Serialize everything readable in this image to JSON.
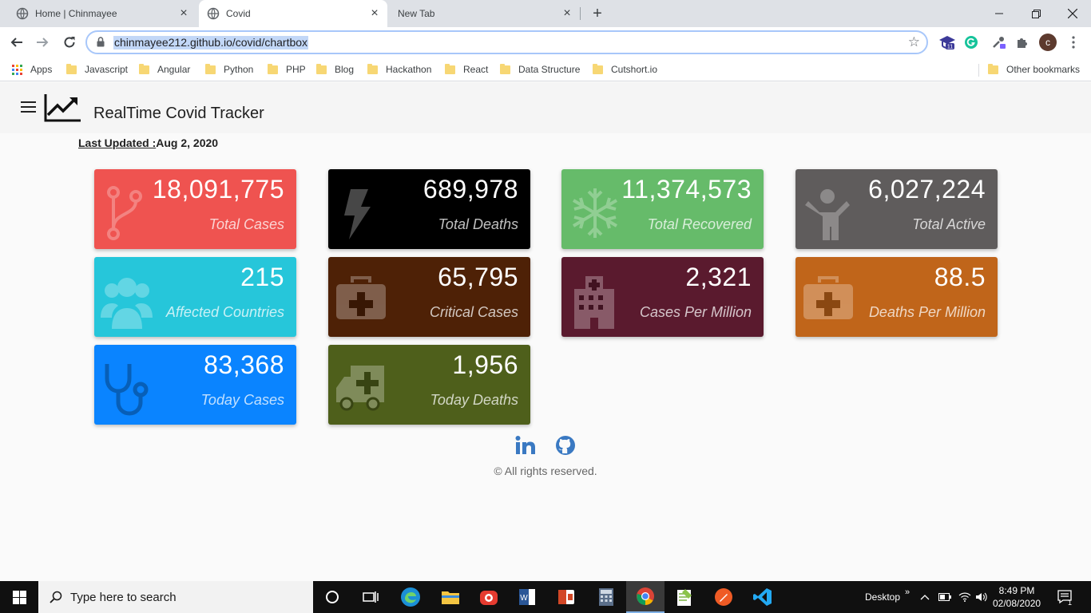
{
  "browser": {
    "tabs": [
      {
        "title": "Home | Chinmayee"
      },
      {
        "title": "Covid"
      },
      {
        "title": "New Tab"
      }
    ],
    "url": "chinmayee212.github.io/covid/chartbox",
    "profile_initial": "c",
    "extension_badge": "11"
  },
  "bookmarks": {
    "apps_label": "Apps",
    "items": [
      "Javascript",
      "Angular",
      "Python",
      "PHP",
      "Blog",
      "Hackathon",
      "React",
      "Data Structure",
      "Cutshort.io"
    ],
    "other": "Other bookmarks"
  },
  "app": {
    "title": "RealTime Covid Tracker",
    "last_updated_label": "Last Updated :",
    "last_updated_value": "Aug 2, 2020"
  },
  "cards": [
    {
      "value": "18,091,775",
      "label": "Total Cases",
      "color": "#ef5350",
      "icon": "code-branch-icon"
    },
    {
      "value": "689,978",
      "label": "Total Deaths",
      "color": "#000000",
      "icon": "bolt-icon"
    },
    {
      "value": "11,374,573",
      "label": "Total Recovered",
      "color": "#66bb6a",
      "icon": "snowflake-icon"
    },
    {
      "value": "6,027,224",
      "label": "Total Active",
      "color": "#5f5c5c",
      "icon": "child-icon"
    },
    {
      "value": "215",
      "label": "Affected Countries",
      "color": "#26c6da",
      "icon": "users-icon"
    },
    {
      "value": "65,795",
      "label": "Critical Cases",
      "color": "#4e2106",
      "icon": "medkit-icon"
    },
    {
      "value": "2,321",
      "label": "Cases Per Million",
      "color": "#5a1a2e",
      "icon": "hospital-icon"
    },
    {
      "value": "88.5",
      "label": "Deaths Per Million",
      "color": "#c0651a",
      "icon": "medkit-icon"
    },
    {
      "value": "83,368",
      "label": "Today Cases",
      "color": "#0a84ff",
      "icon": "stethoscope-icon"
    },
    {
      "value": "1,956",
      "label": "Today Deaths",
      "color": "#4e5f1b",
      "icon": "ambulance-icon"
    }
  ],
  "footer": {
    "linkedin_label": "in",
    "copyright": "© All rights reserved."
  },
  "taskbar": {
    "search_placeholder": "Type here to search",
    "desktop_label": "Desktop",
    "time": "8:49 PM",
    "date": "02/08/2020",
    "notification_count": "1"
  }
}
